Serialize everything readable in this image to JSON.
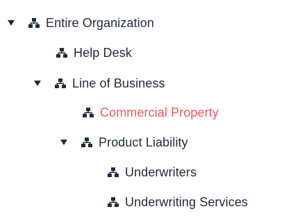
{
  "colors": {
    "text": "#1f2a3a",
    "selected_text": "#f2575d",
    "icon": "#1f2a3a"
  },
  "tree": {
    "nodes": [
      {
        "label": "Entire Organization",
        "expanded": true,
        "icon": "sitemap-icon"
      },
      {
        "label": "Help Desk",
        "icon": "sitemap-icon"
      },
      {
        "label": "Line of Business",
        "expanded": true,
        "icon": "sitemap-icon"
      },
      {
        "label": "Commercial Property",
        "selected": true,
        "icon": "sitemap-icon"
      },
      {
        "label": "Product Liability",
        "expanded": true,
        "icon": "sitemap-icon"
      },
      {
        "label": "Underwriters",
        "icon": "sitemap-icon"
      },
      {
        "label": "Underwriting Services",
        "icon": "sitemap-icon"
      }
    ]
  }
}
